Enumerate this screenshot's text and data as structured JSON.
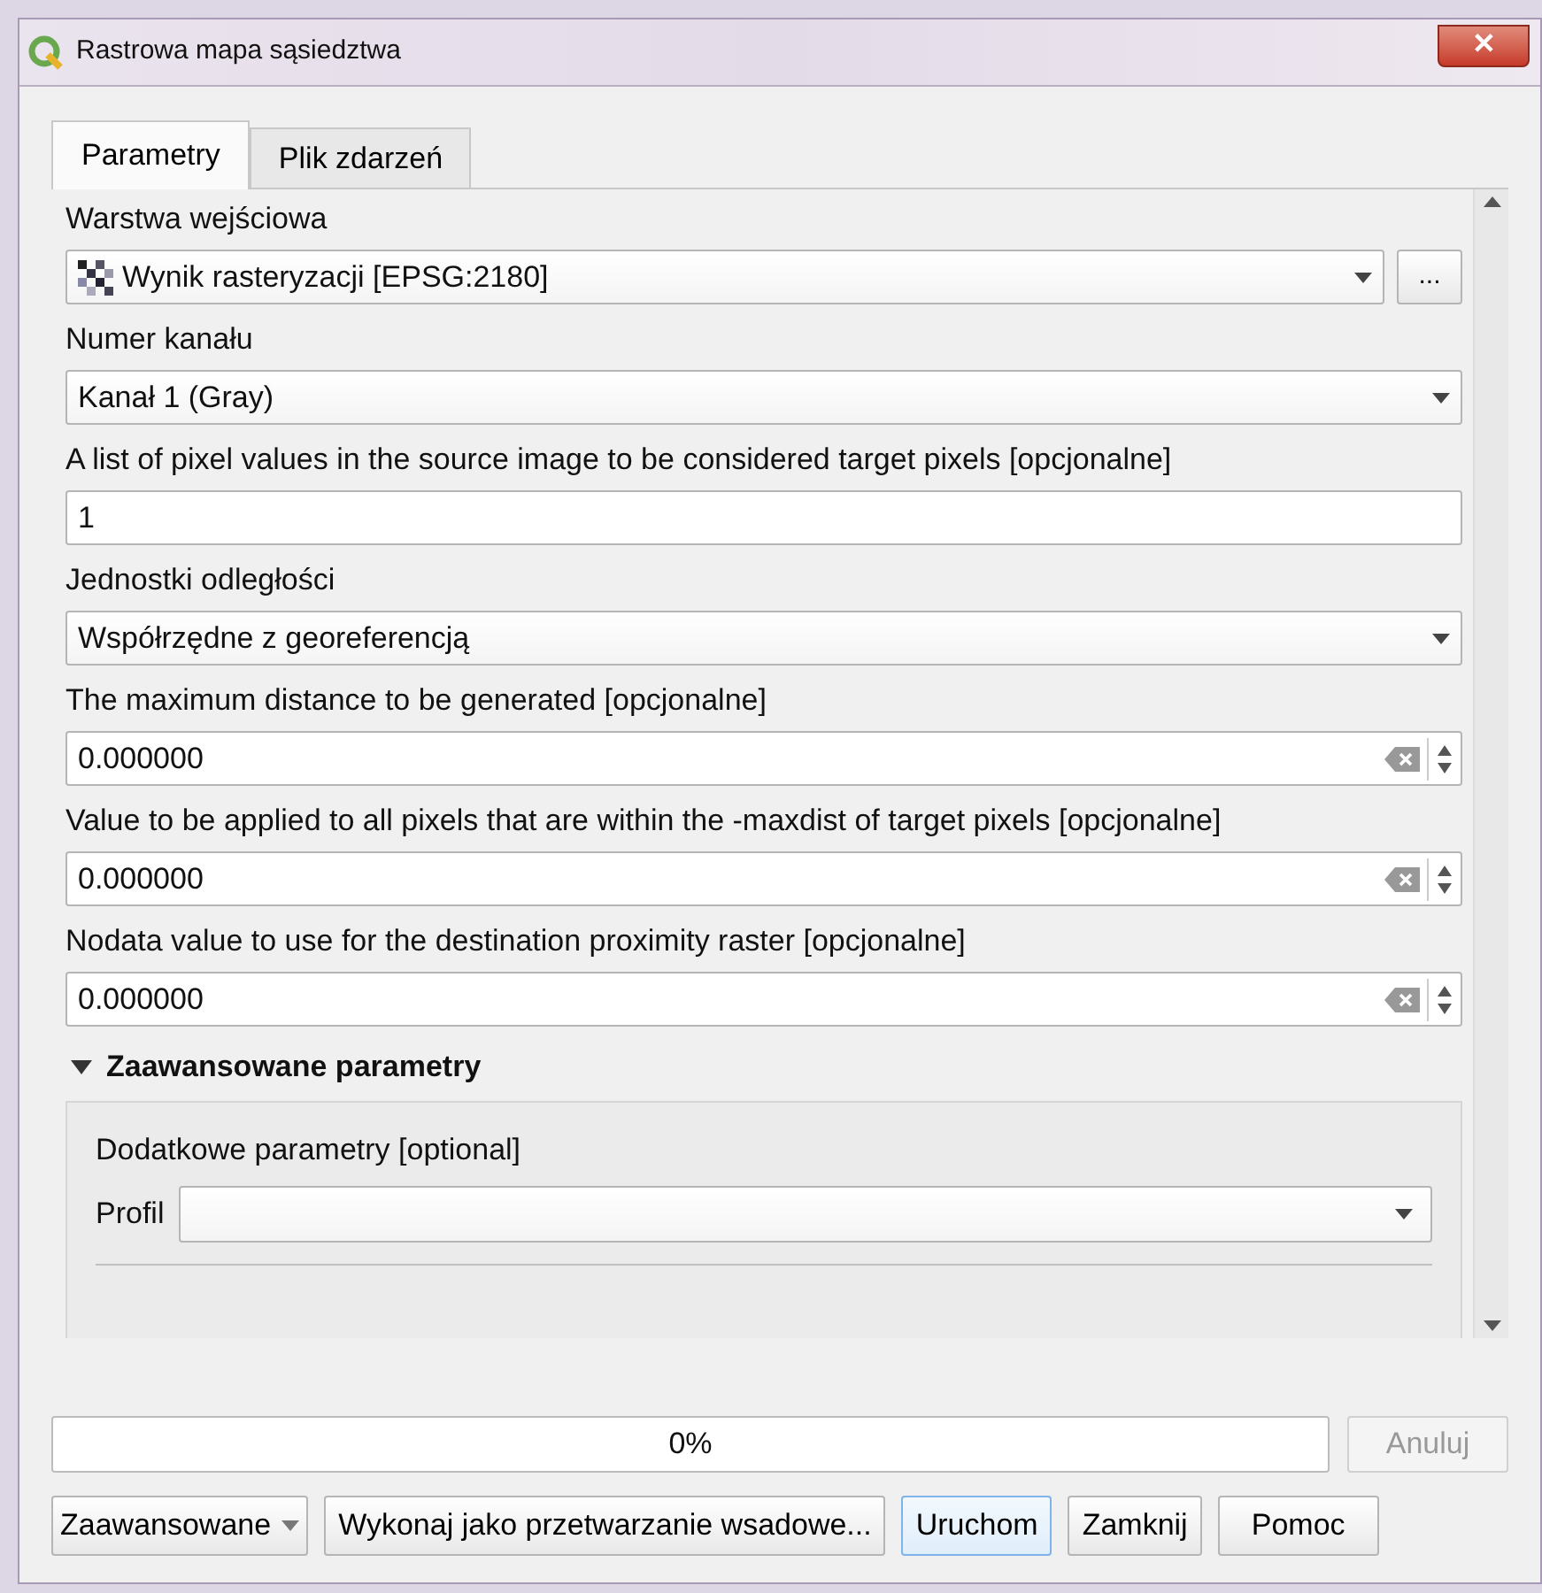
{
  "window": {
    "title": "Rastrowa mapa sąsiedztwa",
    "close": "✕"
  },
  "tabs": [
    {
      "label": "Parametry",
      "selected": true
    },
    {
      "label": "Plik zdarzeń",
      "selected": false
    }
  ],
  "parameters": [
    {
      "kind": "layer",
      "label": "Warstwa wejściowa",
      "value": "Wynik rasteryzacji [EPSG:2180]",
      "button": "..."
    },
    {
      "kind": "combo",
      "label": "Numer kanału",
      "value": "Kanał 1 (Gray)"
    },
    {
      "kind": "text",
      "label": "A list of pixel values in the source image to be considered target pixels [opcjonalne]",
      "value": "1"
    },
    {
      "kind": "combo",
      "label": "Jednostki odległości",
      "value": "Współrzędne z georeferencją"
    },
    {
      "kind": "spin",
      "label": "The maximum distance to be generated [opcjonalne]",
      "value": "0.000000"
    },
    {
      "kind": "spin",
      "label": "Value to be applied to all pixels that are within the -maxdist of target pixels [opcjonalne]",
      "value": "0.000000"
    },
    {
      "kind": "spin",
      "label": "Nodata value to use for the destination proximity raster [opcjonalne]",
      "value": "0.000000"
    }
  ],
  "advanced": {
    "title": "Zaawansowane parametry",
    "expanded": true,
    "label": "Dodatkowe parametry [optional]",
    "profile_label": "Profil"
  },
  "progress": {
    "text": "0%",
    "level": 0
  },
  "cancel": {
    "label": "Anuluj",
    "disabled": true
  },
  "buttons": [
    {
      "kind": "menu",
      "label": "Zaawansowane"
    },
    {
      "kind": "plain",
      "label": "Wykonaj jako przetwarzanie wsadowe..."
    },
    {
      "kind": "default",
      "label": "Uruchom"
    },
    {
      "kind": "plain",
      "label": "Zamknij"
    },
    {
      "kind": "plain",
      "label": "Pomoc"
    }
  ]
}
